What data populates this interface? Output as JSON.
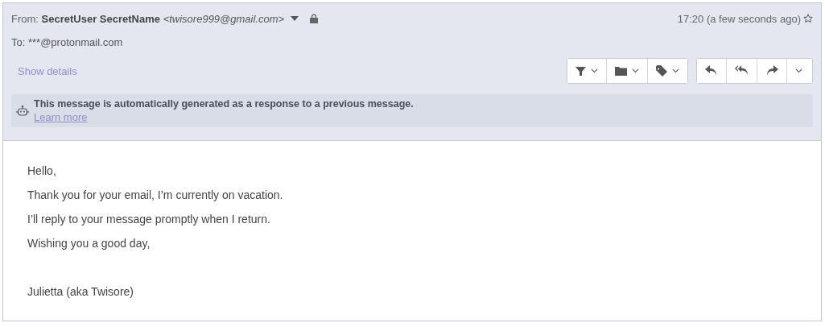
{
  "header": {
    "from_label": "From:",
    "sender_name": "SecretUser SecretName",
    "sender_email": "<twisore999@gmail.com>",
    "to_label": "To:",
    "to_address": "***@protonmail.com",
    "time": "17:20 (a few seconds ago)",
    "show_details": "Show details"
  },
  "toolbar": [
    [
      {
        "kind": "filter",
        "dropdown": true
      },
      {
        "kind": "folder",
        "dropdown": true
      },
      {
        "kind": "label",
        "dropdown": true
      }
    ],
    [
      {
        "kind": "reply",
        "dropdown": false
      },
      {
        "kind": "reply-all",
        "dropdown": false
      },
      {
        "kind": "forward",
        "dropdown": false
      },
      {
        "kind": "more",
        "dropdown": true
      }
    ]
  ],
  "banner": {
    "message": "This message is automatically generated as a response to a previous message.",
    "link": "Learn more"
  },
  "body": {
    "paragraphs": [
      "Hello,",
      "Thank you for your email, I’m currently on vacation.",
      "I’ll reply to your message promptly when I return.",
      "Wishing you a good day,"
    ],
    "signature": "Julietta (aka Twisore)"
  }
}
